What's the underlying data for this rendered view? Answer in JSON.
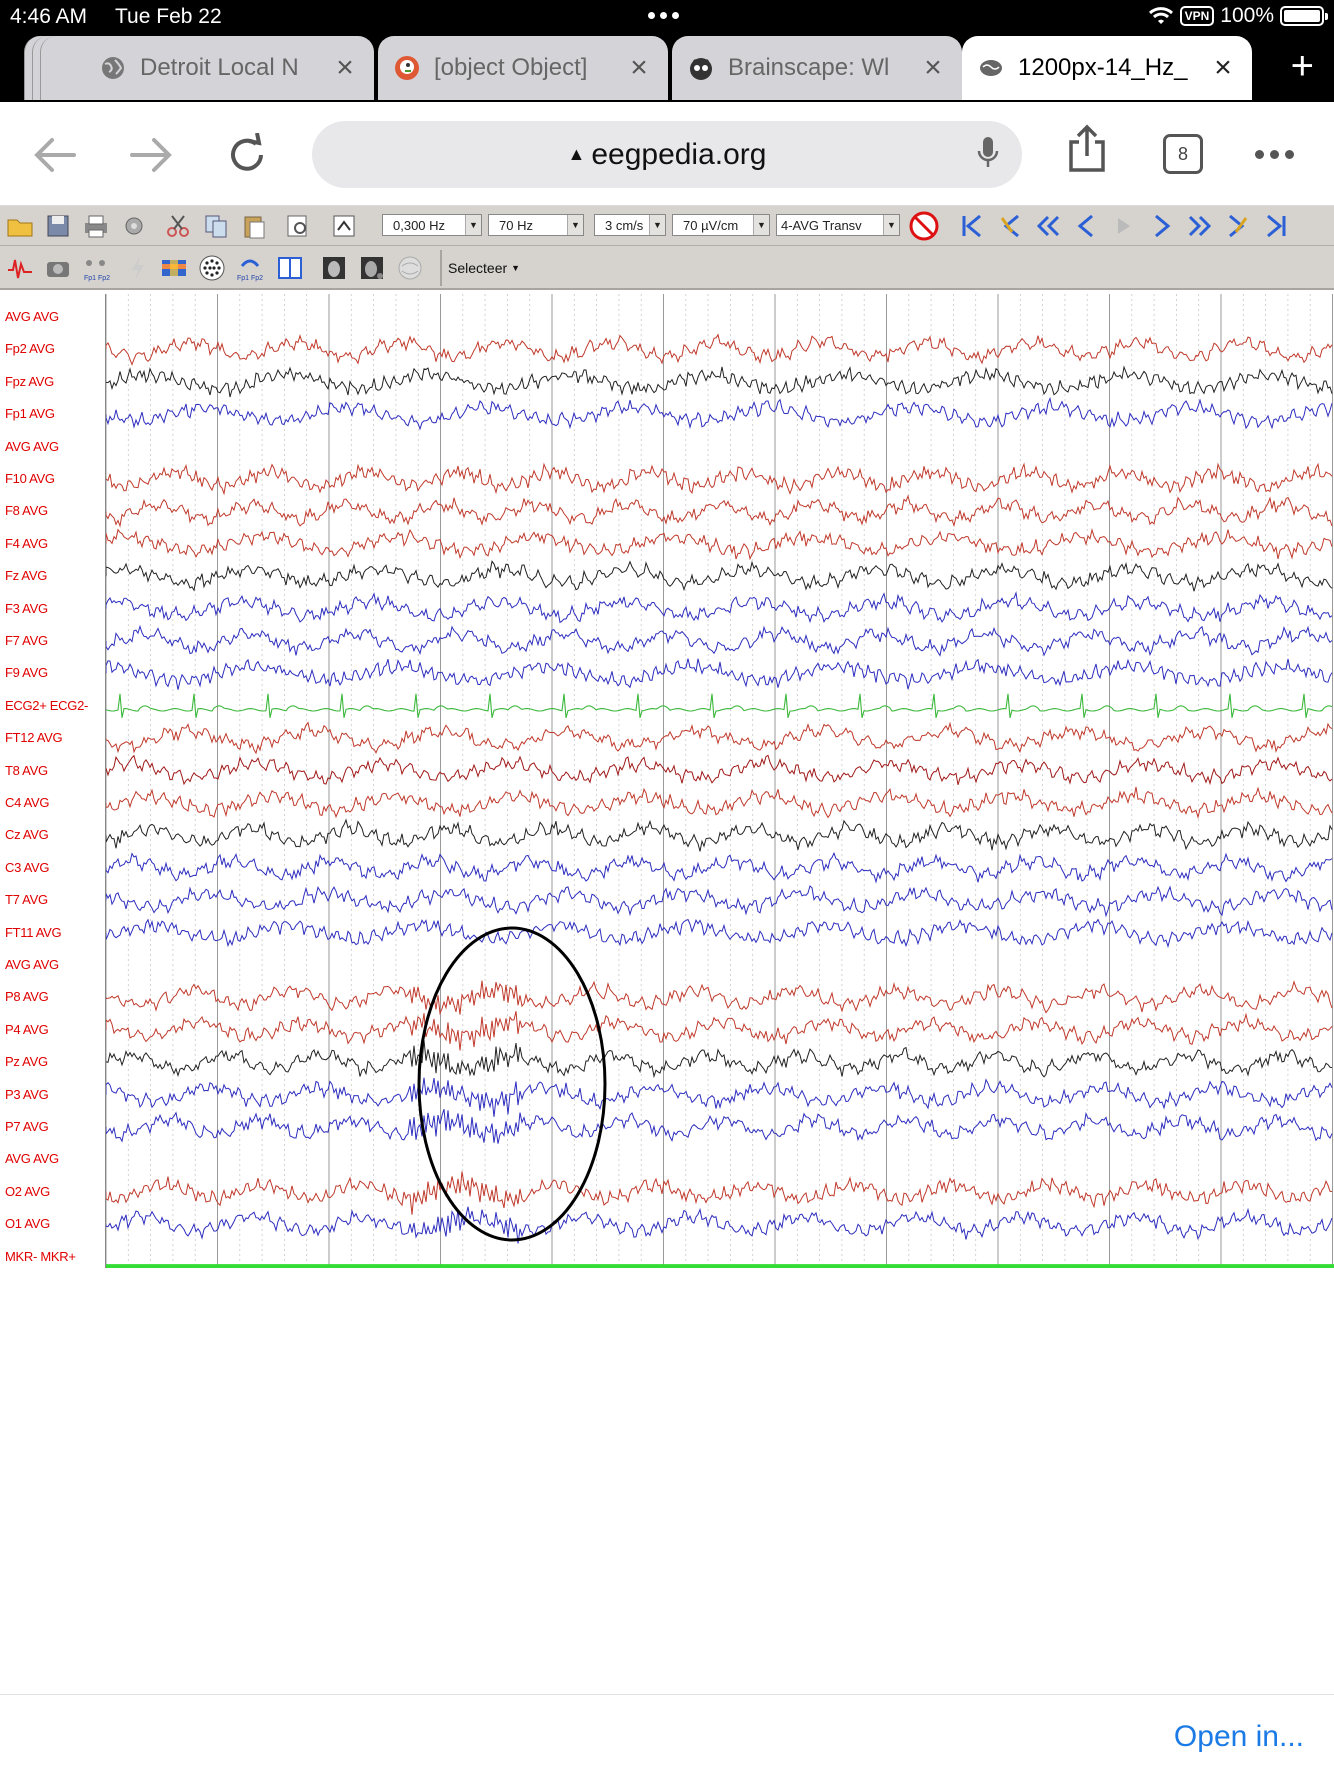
{
  "status_bar": {
    "time": "4:46 AM",
    "date": "Tue Feb 22",
    "vpn": "VPN",
    "battery": "100%"
  },
  "tabs": [
    {
      "title": "Detroit Local N",
      "icon": "globe-icon",
      "active": false
    },
    {
      "title": "[object Object]",
      "icon": "duckduckgo-icon",
      "active": false
    },
    {
      "title": "Brainscape: Wl",
      "icon": "brainscape-icon",
      "active": false
    },
    {
      "title": "1200px-14_Hz_",
      "icon": "brain-icon",
      "active": true
    }
  ],
  "toolbar": {
    "url": "eegpedia.org",
    "tab_count": "8"
  },
  "eeg_app": {
    "low_filter": "0,300 Hz",
    "high_filter": "70 Hz",
    "speed": "3 cm/s",
    "sensitivity": "70 µV/cm",
    "montage": "4-AVG Transv",
    "select_label": "Selecteer",
    "channels": [
      {
        "label": "AVG AVG",
        "color": "#cc3b3b",
        "trace": false
      },
      {
        "label": "Fp2 AVG",
        "color": "#c0392b",
        "trace": true
      },
      {
        "label": "Fpz AVG",
        "color": "#222222",
        "trace": true
      },
      {
        "label": "Fp1 AVG",
        "color": "#2d2dbf",
        "trace": true
      },
      {
        "label": "AVG AVG",
        "color": "#cc3b3b",
        "trace": false
      },
      {
        "label": "F10 AVG",
        "color": "#c0392b",
        "trace": true
      },
      {
        "label": "F8 AVG",
        "color": "#c0392b",
        "trace": true
      },
      {
        "label": "F4 AVG",
        "color": "#c0392b",
        "trace": true
      },
      {
        "label": "Fz AVG",
        "color": "#222222",
        "trace": true
      },
      {
        "label": "F3 AVG",
        "color": "#2d2dbf",
        "trace": true
      },
      {
        "label": "F7 AVG",
        "color": "#2d2dbf",
        "trace": true
      },
      {
        "label": "F9 AVG",
        "color": "#2d2dbf",
        "trace": true
      },
      {
        "label": "ECG2+ ECG2-",
        "color": "#3cb83c",
        "trace": true,
        "ecg": true
      },
      {
        "label": "FT12 AVG",
        "color": "#c0392b",
        "trace": true
      },
      {
        "label": "T8 AVG",
        "color": "#a01818",
        "trace": true
      },
      {
        "label": "C4 AVG",
        "color": "#c0392b",
        "trace": true
      },
      {
        "label": "Cz AVG",
        "color": "#222222",
        "trace": true
      },
      {
        "label": "C3 AVG",
        "color": "#2d2dbf",
        "trace": true
      },
      {
        "label": "T7 AVG",
        "color": "#2d2dbf",
        "trace": true
      },
      {
        "label": "FT11 AVG",
        "color": "#2d2dbf",
        "trace": true
      },
      {
        "label": "AVG AVG",
        "color": "#cc3b3b",
        "trace": false
      },
      {
        "label": "P8 AVG",
        "color": "#c0392b",
        "trace": true
      },
      {
        "label": "P4 AVG",
        "color": "#c0392b",
        "trace": true
      },
      {
        "label": "Pz AVG",
        "color": "#222222",
        "trace": true
      },
      {
        "label": "P3 AVG",
        "color": "#2d2dbf",
        "trace": true
      },
      {
        "label": "P7 AVG",
        "color": "#2d2dbf",
        "trace": true
      },
      {
        "label": "AVG AVG",
        "color": "#cc3b3b",
        "trace": false
      },
      {
        "label": "O2 AVG",
        "color": "#c0392b",
        "trace": true
      },
      {
        "label": "O1 AVG",
        "color": "#2d2dbf",
        "trace": true
      },
      {
        "label": "MKR- MKR+",
        "color": "#33dd33",
        "trace": true,
        "marker": true
      }
    ]
  },
  "footer": {
    "open_in": "Open in..."
  }
}
